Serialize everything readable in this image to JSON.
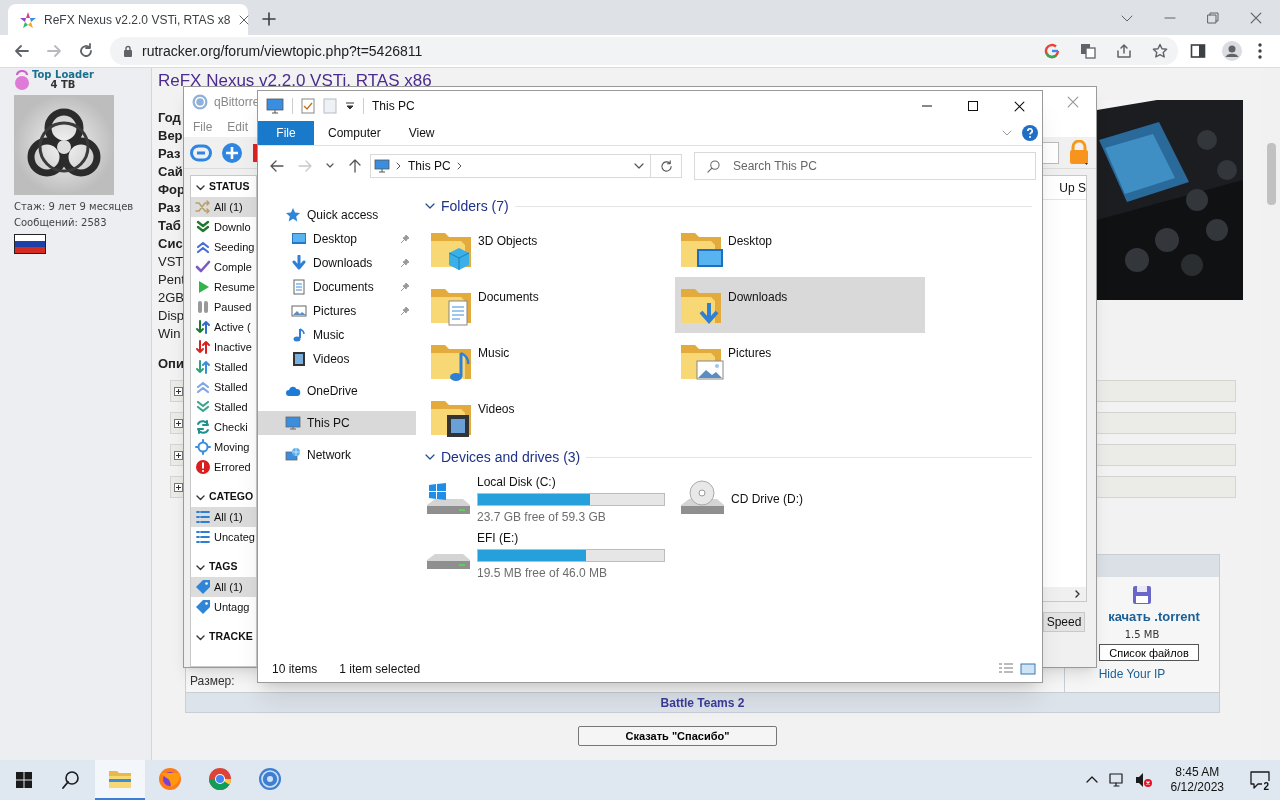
{
  "browser": {
    "tabs": [
      {
        "title": "ReFX Nexus v2.2.0 VSTi, RTAS x8",
        "selected": true
      }
    ],
    "url": "rutracker.org/forum/viewtopic.php?t=5426811"
  },
  "user": {
    "rank": "Top Loader",
    "volume": "4 TB",
    "tenure": "Стаж: 9 лет 9 месяцев",
    "posts": "Сообщений: 2583"
  },
  "post": {
    "title": "ReFX Nexus v2.2.0 VSTi, RTAS x86",
    "fields": [
      {
        "text": "Год",
        "bold": true
      },
      {
        "text": "Вер",
        "bold": true
      },
      {
        "text": "Раз",
        "bold": true
      },
      {
        "text": "Сай",
        "bold": true
      },
      {
        "text": "Фор",
        "bold": true
      },
      {
        "text": "Раз",
        "bold": true
      },
      {
        "text": "Таб",
        "bold": true
      },
      {
        "text": "Сис",
        "bold": true
      },
      {
        "text": "VST",
        "bold": false
      },
      {
        "text": "Pent",
        "bold": false
      },
      {
        "text": "2GB",
        "bold": false
      },
      {
        "text": "Disp",
        "bold": false
      },
      {
        "text": "Win",
        "bold": false
      }
    ],
    "description_label": "Опи",
    "spoilers": [
      {
        "expanded": false
      },
      {
        "expanded": false
      },
      {
        "expanded": false
      },
      {
        "expanded": false
      }
    ],
    "size_label": "Размер:",
    "download": {
      "link": "качать .torrent",
      "size": "1.5 MB",
      "files_button": "Список файлов",
      "hide_ip": "Hide Your IP"
    },
    "release_bar": "Battle Teams 2",
    "thanks_button": "Сказать \"Спасибо\""
  },
  "qbittorrent": {
    "title": "qBittorre",
    "menu": [
      "File",
      "Edit"
    ],
    "sections": [
      {
        "header": "STATUS",
        "expanded": true,
        "items": [
          {
            "label": "All (1)",
            "selected": true
          },
          {
            "label": "Downlo",
            "selected": false
          },
          {
            "label": "Seeding",
            "selected": false
          },
          {
            "label": "Comple",
            "selected": false
          },
          {
            "label": "Resume",
            "selected": false
          },
          {
            "label": "Paused",
            "selected": false
          },
          {
            "label": "Active (",
            "selected": false
          },
          {
            "label": "Inactive",
            "selected": false
          },
          {
            "label": "Stalled",
            "selected": false
          },
          {
            "label": "Stalled",
            "selected": false
          },
          {
            "label": "Stalled",
            "selected": false
          },
          {
            "label": "Checki",
            "selected": false
          },
          {
            "label": "Moving",
            "selected": false
          },
          {
            "label": "Errored",
            "selected": false
          }
        ]
      },
      {
        "header": "CATEGO",
        "expanded": true,
        "items": [
          {
            "label": "All (1)",
            "selected": true
          },
          {
            "label": "Uncateg",
            "selected": false
          }
        ]
      },
      {
        "header": "TAGS",
        "expanded": true,
        "items": [
          {
            "label": "All (1)",
            "selected": true
          },
          {
            "label": "Untagg",
            "selected": false
          }
        ]
      },
      {
        "header": "TRACKE",
        "expanded": true
      }
    ],
    "column_header": "Up S",
    "speed_button": "Speed"
  },
  "explorer": {
    "title": "This PC",
    "ribbon_tabs": [
      {
        "label": "File",
        "selected": true
      },
      {
        "label": "Computer",
        "selected": false
      },
      {
        "label": "View",
        "selected": false
      }
    ],
    "address": "This PC",
    "search_placeholder": "Search This PC",
    "nav": [
      {
        "label": "Quick access",
        "selected": false,
        "children": [
          {
            "label": "Desktop",
            "selected": false,
            "pinned": true
          },
          {
            "label": "Downloads",
            "selected": false,
            "pinned": true
          },
          {
            "label": "Documents",
            "selected": false,
            "pinned": true
          },
          {
            "label": "Pictures",
            "selected": false,
            "pinned": true
          },
          {
            "label": "Music",
            "selected": false,
            "pinned": false
          },
          {
            "label": "Videos",
            "selected": false,
            "pinned": false
          }
        ]
      },
      {
        "label": "OneDrive",
        "selected": false
      },
      {
        "label": "This PC",
        "selected": true
      },
      {
        "label": "Network",
        "selected": false
      }
    ],
    "folders_header": "Folders (7)",
    "folders": [
      {
        "name": "3D Objects",
        "selected": false
      },
      {
        "name": "Desktop",
        "selected": false
      },
      {
        "name": "Documents",
        "selected": false
      },
      {
        "name": "Downloads",
        "selected": true
      },
      {
        "name": "Music",
        "selected": false
      },
      {
        "name": "Pictures",
        "selected": false
      },
      {
        "name": "Videos",
        "selected": false
      }
    ],
    "drives_header": "Devices and drives (3)",
    "drives": [
      {
        "kind": "disk",
        "name": "Local Disk (C:)",
        "system": true,
        "level": 0.6,
        "free": "23.7 GB free of 59.3 GB"
      },
      {
        "kind": "cd",
        "name": "CD Drive (D:)"
      },
      {
        "kind": "disk",
        "name": "EFI (E:)",
        "system": false,
        "level": 0.58,
        "free": "19.5 MB free of 46.0 MB"
      }
    ],
    "status_count": "10 items",
    "status_selection": "1 item selected"
  },
  "taskbar": {
    "apps": [
      {
        "selected": true
      },
      {
        "selected": false
      },
      {
        "selected": false
      },
      {
        "selected": false
      }
    ],
    "muted": true,
    "time": "8:45 AM",
    "date": "6/12/2023",
    "notifications": "2"
  }
}
